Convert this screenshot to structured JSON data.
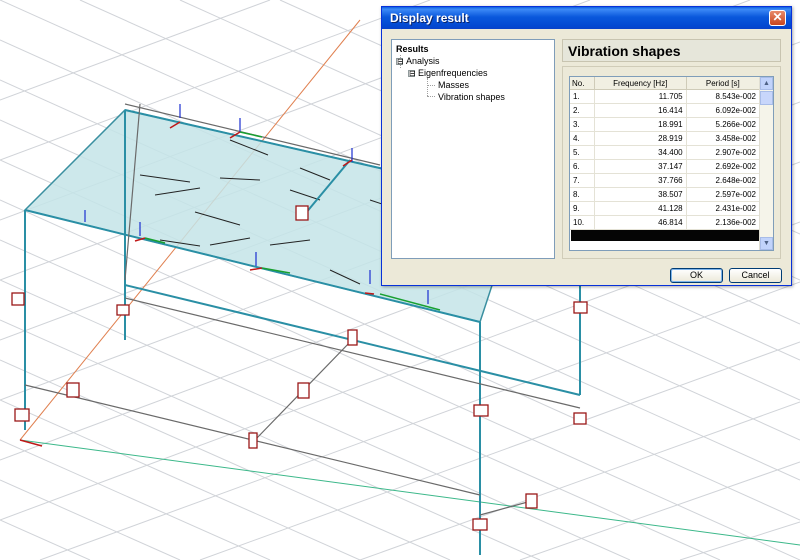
{
  "dialog": {
    "title": "Display result",
    "close_symbol": "✕",
    "ok_label": "OK",
    "cancel_label": "Cancel"
  },
  "tree": {
    "root": "Results",
    "items": [
      {
        "label": "Analysis",
        "toggle": "⊟"
      },
      {
        "label": "Eigenfrequencies",
        "toggle": "⊟"
      },
      {
        "label": "Masses"
      },
      {
        "label": "Vibration shapes"
      }
    ]
  },
  "panel": {
    "title": "Vibration shapes"
  },
  "table": {
    "columns": [
      "No.",
      "Frequency [Hz]",
      "Period [s]"
    ],
    "rows": [
      {
        "no": "1.",
        "freq": "11.705",
        "period": "8.543e-002"
      },
      {
        "no": "2.",
        "freq": "16.414",
        "period": "6.092e-002"
      },
      {
        "no": "3.",
        "freq": "18.991",
        "period": "5.266e-002"
      },
      {
        "no": "4.",
        "freq": "28.919",
        "period": "3.458e-002"
      },
      {
        "no": "5.",
        "freq": "34.400",
        "period": "2.907e-002"
      },
      {
        "no": "6.",
        "freq": "37.147",
        "period": "2.692e-002"
      },
      {
        "no": "7.",
        "freq": "37.766",
        "period": "2.648e-002"
      },
      {
        "no": "8.",
        "freq": "38.507",
        "period": "2.597e-002"
      },
      {
        "no": "9.",
        "freq": "41.128",
        "period": "2.431e-002"
      },
      {
        "no": "10.",
        "freq": "46.814",
        "period": "2.136e-002"
      }
    ]
  },
  "icons": {
    "scroll_up": "▲",
    "scroll_down": "▼"
  }
}
